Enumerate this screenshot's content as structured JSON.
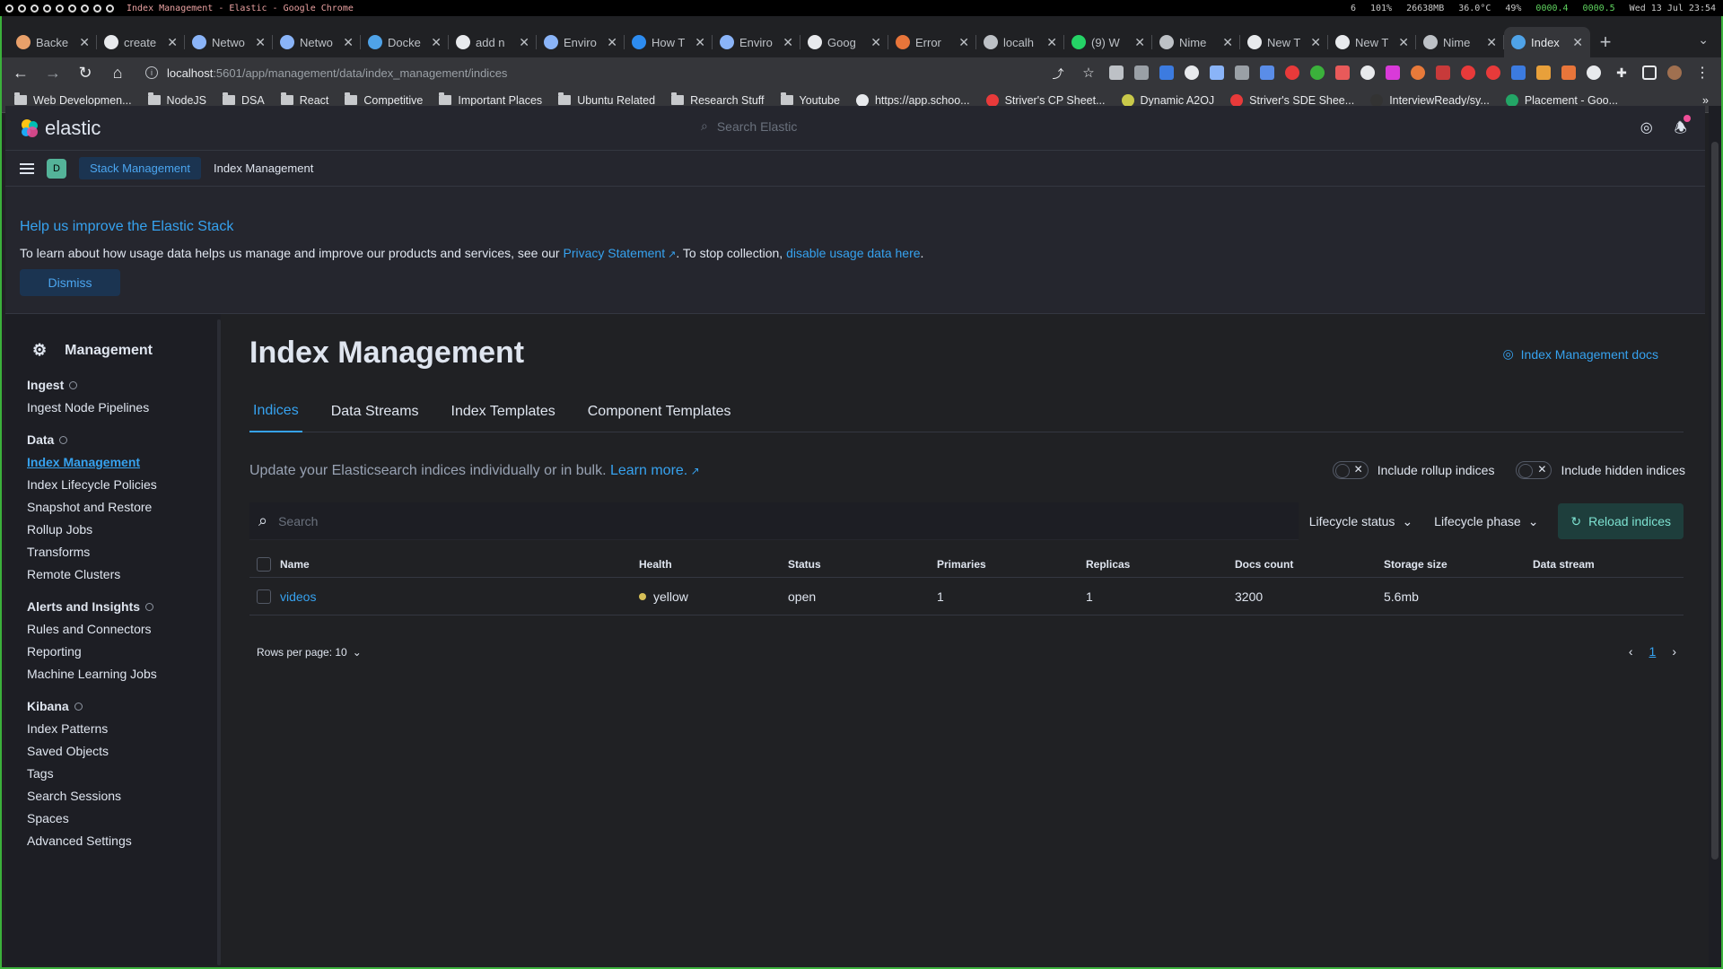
{
  "os": {
    "window_title": "Index Management - Elastic - Google Chrome",
    "status": [
      "6",
      "101%",
      "26638MB",
      "36.0°C",
      "49%",
      "0000.4",
      "0000.5",
      "Wed 13 Jul 23:54"
    ]
  },
  "browser": {
    "tabs": [
      {
        "label": "Backe",
        "fav": "#e8a06a"
      },
      {
        "label": "create",
        "fav": "#e8eaed"
      },
      {
        "label": "Netwo",
        "fav": "#8ab4f8"
      },
      {
        "label": "Netwo",
        "fav": "#8ab4f8"
      },
      {
        "label": "Docke",
        "fav": "#4fa3e8"
      },
      {
        "label": "add n",
        "fav": "#e8eaed"
      },
      {
        "label": "Enviro",
        "fav": "#8ab4f8"
      },
      {
        "label": "How T",
        "fav": "#2d8cf0"
      },
      {
        "label": "Enviro",
        "fav": "#8ab4f8"
      },
      {
        "label": "Goog",
        "fav": "#e8eaed"
      },
      {
        "label": "Error",
        "fav": "#e8753a"
      },
      {
        "label": "localh",
        "fav": "#bdc1c6"
      },
      {
        "label": "(9) W",
        "fav": "#25d366"
      },
      {
        "label": "Nime",
        "fav": "#bdc1c6"
      },
      {
        "label": "New T",
        "fav": "#e8eaed"
      },
      {
        "label": "New T",
        "fav": "#e8eaed"
      },
      {
        "label": "Nime",
        "fav": "#bdc1c6"
      },
      {
        "label": "Index",
        "fav": "#4fa3e8"
      }
    ],
    "url_host": "localhost",
    "url_path": ":5601/app/management/data/index_management/indices",
    "bookmarks": [
      {
        "label": "Web Developmen...",
        "type": "folder"
      },
      {
        "label": "NodeJS",
        "type": "folder"
      },
      {
        "label": "DSA",
        "type": "folder"
      },
      {
        "label": "React",
        "type": "folder"
      },
      {
        "label": "Competitive",
        "type": "folder"
      },
      {
        "label": "Important Places",
        "type": "folder"
      },
      {
        "label": "Ubuntu Related",
        "type": "folder"
      },
      {
        "label": "Research Stuff",
        "type": "folder"
      },
      {
        "label": "Youtube",
        "type": "folder"
      },
      {
        "label": "https://app.schoo...",
        "type": "site",
        "color": "#e8eaed"
      },
      {
        "label": "Striver's CP Sheet...",
        "type": "site",
        "color": "#e83a3a"
      },
      {
        "label": "Dynamic A2OJ",
        "type": "site",
        "color": "#c9c94a"
      },
      {
        "label": "Striver's SDE Shee...",
        "type": "site",
        "color": "#e83a3a"
      },
      {
        "label": "InterviewReady/sy...",
        "type": "site",
        "color": "#333"
      },
      {
        "label": "Placement - Goo...",
        "type": "site",
        "color": "#23a566"
      }
    ],
    "bookmarks_more": "»"
  },
  "kibana": {
    "brand": "elastic",
    "search_placeholder": "Search Elastic",
    "space_initial": "D",
    "breadcrumbs": [
      "Stack Management",
      "Index Management"
    ],
    "banner": {
      "title": "Help us improve the Elastic Stack",
      "text_before": "To learn about how usage data helps us manage and improve our products and services, see our ",
      "privacy_link": "Privacy Statement",
      "text_middle": ". To stop collection, ",
      "disable_link": "disable usage data here",
      "text_after": ".",
      "dismiss": "Dismiss"
    },
    "sidenav": {
      "title": "Management",
      "groups": [
        {
          "title": "Ingest",
          "items": [
            "Ingest Node Pipelines"
          ]
        },
        {
          "title": "Data",
          "items": [
            "Index Management",
            "Index Lifecycle Policies",
            "Snapshot and Restore",
            "Rollup Jobs",
            "Transforms",
            "Remote Clusters"
          ]
        },
        {
          "title": "Alerts and Insights",
          "items": [
            "Rules and Connectors",
            "Reporting",
            "Machine Learning Jobs"
          ]
        },
        {
          "title": "Kibana",
          "items": [
            "Index Patterns",
            "Saved Objects",
            "Tags",
            "Search Sessions",
            "Spaces",
            "Advanced Settings"
          ]
        }
      ],
      "active": "Index Management"
    },
    "page": {
      "title": "Index Management",
      "docs_link": "Index Management docs",
      "tabs": [
        "Indices",
        "Data Streams",
        "Index Templates",
        "Component Templates"
      ],
      "active_tab": "Indices",
      "description": "Update your Elasticsearch indices individually or in bulk.",
      "learn_more": "Learn more.",
      "switch_rollup": "Include rollup indices",
      "switch_hidden": "Include hidden indices",
      "search_placeholder": "Search",
      "filter_lifecycle_status": "Lifecycle status",
      "filter_lifecycle_phase": "Lifecycle phase",
      "reload": "Reload indices",
      "columns": [
        "Name",
        "Health",
        "Status",
        "Primaries",
        "Replicas",
        "Docs count",
        "Storage size",
        "Data stream"
      ],
      "rows": [
        {
          "name": "videos",
          "health": "yellow",
          "status": "open",
          "primaries": "1",
          "replicas": "1",
          "docs_count": "3200",
          "storage_size": "5.6mb",
          "data_stream": ""
        }
      ],
      "rows_per_page": "Rows per page: 10",
      "current_page": "1"
    }
  }
}
